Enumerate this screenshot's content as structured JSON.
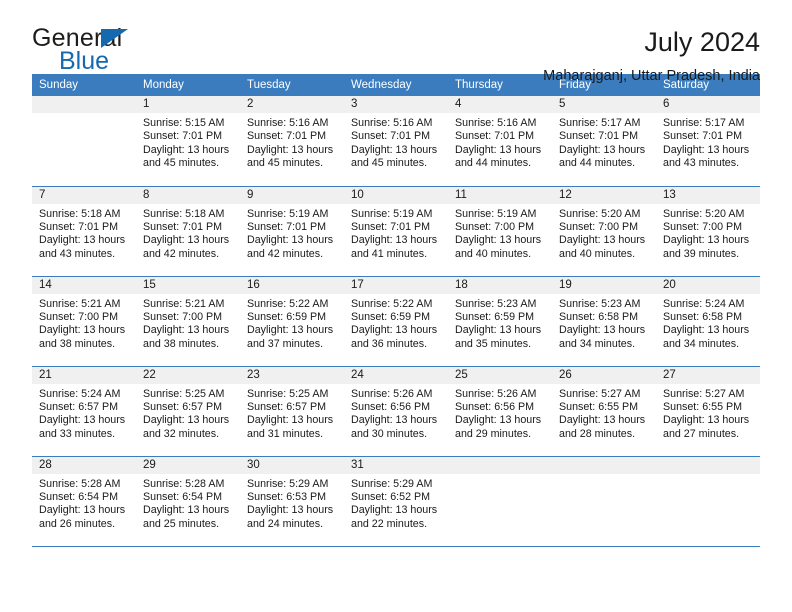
{
  "brand": {
    "word1": "General",
    "word2": "Blue",
    "triangle_icon": "triangle-icon",
    "accent_color": "#1469b0"
  },
  "header": {
    "title": "July 2024",
    "subtitle": "Maharajganj, Uttar Pradesh, India"
  },
  "theme": {
    "header_row_bg": "#3a7cbe",
    "daynum_band_bg": "#f0f0f0",
    "row_border": "#3a7cbe",
    "text": "#1a1a1a"
  },
  "calendar": {
    "day_headers": [
      "Sunday",
      "Monday",
      "Tuesday",
      "Wednesday",
      "Thursday",
      "Friday",
      "Saturday"
    ],
    "weeks": [
      [
        {
          "day": "",
          "sunrise": "",
          "sunset": "",
          "daylight_line1": "",
          "daylight_line2": ""
        },
        {
          "day": "1",
          "sunrise": "Sunrise: 5:15 AM",
          "sunset": "Sunset: 7:01 PM",
          "daylight_line1": "Daylight: 13 hours",
          "daylight_line2": "and 45 minutes."
        },
        {
          "day": "2",
          "sunrise": "Sunrise: 5:16 AM",
          "sunset": "Sunset: 7:01 PM",
          "daylight_line1": "Daylight: 13 hours",
          "daylight_line2": "and 45 minutes."
        },
        {
          "day": "3",
          "sunrise": "Sunrise: 5:16 AM",
          "sunset": "Sunset: 7:01 PM",
          "daylight_line1": "Daylight: 13 hours",
          "daylight_line2": "and 45 minutes."
        },
        {
          "day": "4",
          "sunrise": "Sunrise: 5:16 AM",
          "sunset": "Sunset: 7:01 PM",
          "daylight_line1": "Daylight: 13 hours",
          "daylight_line2": "and 44 minutes."
        },
        {
          "day": "5",
          "sunrise": "Sunrise: 5:17 AM",
          "sunset": "Sunset: 7:01 PM",
          "daylight_line1": "Daylight: 13 hours",
          "daylight_line2": "and 44 minutes."
        },
        {
          "day": "6",
          "sunrise": "Sunrise: 5:17 AM",
          "sunset": "Sunset: 7:01 PM",
          "daylight_line1": "Daylight: 13 hours",
          "daylight_line2": "and 43 minutes."
        }
      ],
      [
        {
          "day": "7",
          "sunrise": "Sunrise: 5:18 AM",
          "sunset": "Sunset: 7:01 PM",
          "daylight_line1": "Daylight: 13 hours",
          "daylight_line2": "and 43 minutes."
        },
        {
          "day": "8",
          "sunrise": "Sunrise: 5:18 AM",
          "sunset": "Sunset: 7:01 PM",
          "daylight_line1": "Daylight: 13 hours",
          "daylight_line2": "and 42 minutes."
        },
        {
          "day": "9",
          "sunrise": "Sunrise: 5:19 AM",
          "sunset": "Sunset: 7:01 PM",
          "daylight_line1": "Daylight: 13 hours",
          "daylight_line2": "and 42 minutes."
        },
        {
          "day": "10",
          "sunrise": "Sunrise: 5:19 AM",
          "sunset": "Sunset: 7:01 PM",
          "daylight_line1": "Daylight: 13 hours",
          "daylight_line2": "and 41 minutes."
        },
        {
          "day": "11",
          "sunrise": "Sunrise: 5:19 AM",
          "sunset": "Sunset: 7:00 PM",
          "daylight_line1": "Daylight: 13 hours",
          "daylight_line2": "and 40 minutes."
        },
        {
          "day": "12",
          "sunrise": "Sunrise: 5:20 AM",
          "sunset": "Sunset: 7:00 PM",
          "daylight_line1": "Daylight: 13 hours",
          "daylight_line2": "and 40 minutes."
        },
        {
          "day": "13",
          "sunrise": "Sunrise: 5:20 AM",
          "sunset": "Sunset: 7:00 PM",
          "daylight_line1": "Daylight: 13 hours",
          "daylight_line2": "and 39 minutes."
        }
      ],
      [
        {
          "day": "14",
          "sunrise": "Sunrise: 5:21 AM",
          "sunset": "Sunset: 7:00 PM",
          "daylight_line1": "Daylight: 13 hours",
          "daylight_line2": "and 38 minutes."
        },
        {
          "day": "15",
          "sunrise": "Sunrise: 5:21 AM",
          "sunset": "Sunset: 7:00 PM",
          "daylight_line1": "Daylight: 13 hours",
          "daylight_line2": "and 38 minutes."
        },
        {
          "day": "16",
          "sunrise": "Sunrise: 5:22 AM",
          "sunset": "Sunset: 6:59 PM",
          "daylight_line1": "Daylight: 13 hours",
          "daylight_line2": "and 37 minutes."
        },
        {
          "day": "17",
          "sunrise": "Sunrise: 5:22 AM",
          "sunset": "Sunset: 6:59 PM",
          "daylight_line1": "Daylight: 13 hours",
          "daylight_line2": "and 36 minutes."
        },
        {
          "day": "18",
          "sunrise": "Sunrise: 5:23 AM",
          "sunset": "Sunset: 6:59 PM",
          "daylight_line1": "Daylight: 13 hours",
          "daylight_line2": "and 35 minutes."
        },
        {
          "day": "19",
          "sunrise": "Sunrise: 5:23 AM",
          "sunset": "Sunset: 6:58 PM",
          "daylight_line1": "Daylight: 13 hours",
          "daylight_line2": "and 34 minutes."
        },
        {
          "day": "20",
          "sunrise": "Sunrise: 5:24 AM",
          "sunset": "Sunset: 6:58 PM",
          "daylight_line1": "Daylight: 13 hours",
          "daylight_line2": "and 34 minutes."
        }
      ],
      [
        {
          "day": "21",
          "sunrise": "Sunrise: 5:24 AM",
          "sunset": "Sunset: 6:57 PM",
          "daylight_line1": "Daylight: 13 hours",
          "daylight_line2": "and 33 minutes."
        },
        {
          "day": "22",
          "sunrise": "Sunrise: 5:25 AM",
          "sunset": "Sunset: 6:57 PM",
          "daylight_line1": "Daylight: 13 hours",
          "daylight_line2": "and 32 minutes."
        },
        {
          "day": "23",
          "sunrise": "Sunrise: 5:25 AM",
          "sunset": "Sunset: 6:57 PM",
          "daylight_line1": "Daylight: 13 hours",
          "daylight_line2": "and 31 minutes."
        },
        {
          "day": "24",
          "sunrise": "Sunrise: 5:26 AM",
          "sunset": "Sunset: 6:56 PM",
          "daylight_line1": "Daylight: 13 hours",
          "daylight_line2": "and 30 minutes."
        },
        {
          "day": "25",
          "sunrise": "Sunrise: 5:26 AM",
          "sunset": "Sunset: 6:56 PM",
          "daylight_line1": "Daylight: 13 hours",
          "daylight_line2": "and 29 minutes."
        },
        {
          "day": "26",
          "sunrise": "Sunrise: 5:27 AM",
          "sunset": "Sunset: 6:55 PM",
          "daylight_line1": "Daylight: 13 hours",
          "daylight_line2": "and 28 minutes."
        },
        {
          "day": "27",
          "sunrise": "Sunrise: 5:27 AM",
          "sunset": "Sunset: 6:55 PM",
          "daylight_line1": "Daylight: 13 hours",
          "daylight_line2": "and 27 minutes."
        }
      ],
      [
        {
          "day": "28",
          "sunrise": "Sunrise: 5:28 AM",
          "sunset": "Sunset: 6:54 PM",
          "daylight_line1": "Daylight: 13 hours",
          "daylight_line2": "and 26 minutes."
        },
        {
          "day": "29",
          "sunrise": "Sunrise: 5:28 AM",
          "sunset": "Sunset: 6:54 PM",
          "daylight_line1": "Daylight: 13 hours",
          "daylight_line2": "and 25 minutes."
        },
        {
          "day": "30",
          "sunrise": "Sunrise: 5:29 AM",
          "sunset": "Sunset: 6:53 PM",
          "daylight_line1": "Daylight: 13 hours",
          "daylight_line2": "and 24 minutes."
        },
        {
          "day": "31",
          "sunrise": "Sunrise: 5:29 AM",
          "sunset": "Sunset: 6:52 PM",
          "daylight_line1": "Daylight: 13 hours",
          "daylight_line2": "and 22 minutes."
        },
        {
          "day": "",
          "sunrise": "",
          "sunset": "",
          "daylight_line1": "",
          "daylight_line2": ""
        },
        {
          "day": "",
          "sunrise": "",
          "sunset": "",
          "daylight_line1": "",
          "daylight_line2": ""
        },
        {
          "day": "",
          "sunrise": "",
          "sunset": "",
          "daylight_line1": "",
          "daylight_line2": ""
        }
      ]
    ]
  }
}
